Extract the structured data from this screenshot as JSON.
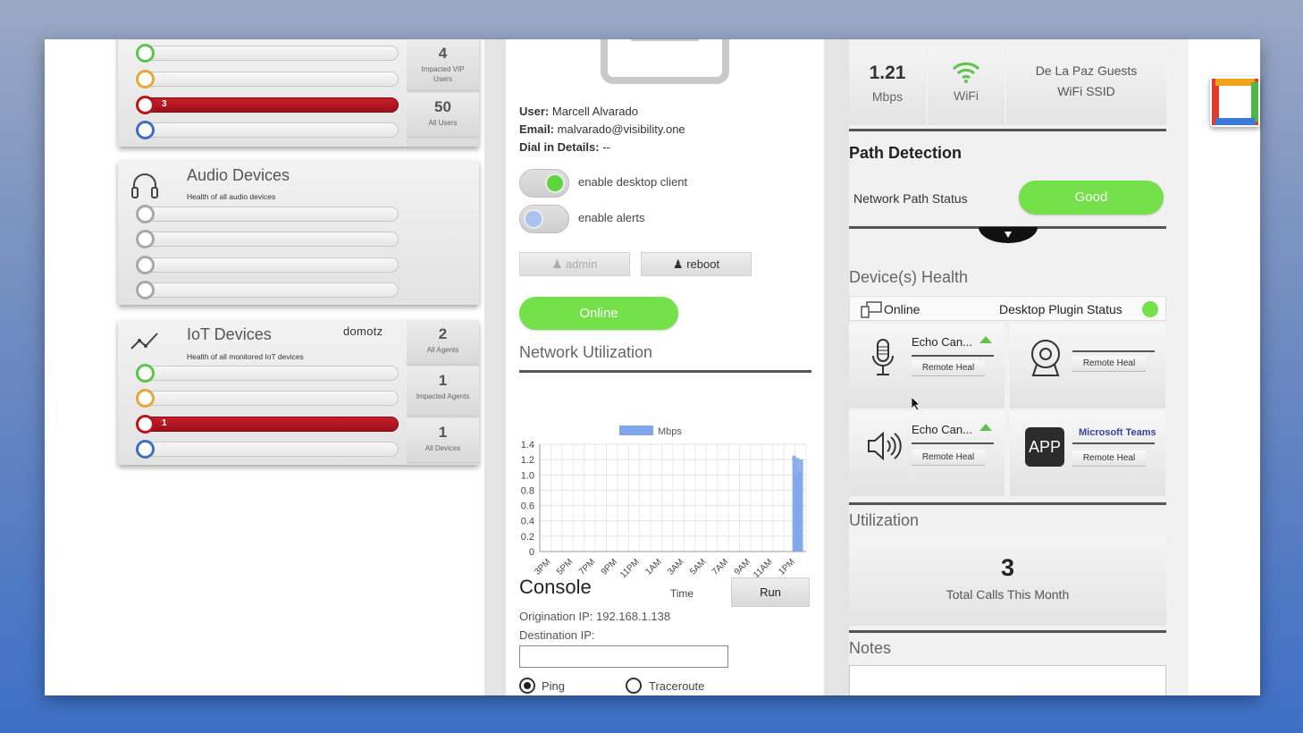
{
  "left": {
    "users_card": {
      "bars": [
        {
          "value": "0",
          "color": "green"
        },
        {
          "value": "0",
          "color": "orange"
        },
        {
          "value": "3",
          "color": "red"
        },
        {
          "value": "0",
          "color": "blue"
        }
      ],
      "stats": [
        {
          "num": "4",
          "label": "Impacted VIP Users"
        },
        {
          "num": "50",
          "label": "All Users"
        }
      ]
    },
    "audio_card": {
      "title": "Audio Devices",
      "subtitle": "Health of all audio devices"
    },
    "iot_card": {
      "title": "IoT Devices",
      "subtitle": "Health of all monitored IoT devices",
      "brand": "domotz",
      "bars": [
        {
          "value": "0",
          "color": "green"
        },
        {
          "value": "0",
          "color": "orange"
        },
        {
          "value": "1",
          "color": "red"
        },
        {
          "value": "0",
          "color": "blue"
        }
      ],
      "stats": [
        {
          "num": "2",
          "label": "All Agents"
        },
        {
          "num": "1",
          "label": "Impacted Agents"
        },
        {
          "num": "1",
          "label": "All Devices"
        }
      ]
    }
  },
  "user": {
    "user_label": "User:",
    "user_value": "Marcell Alvarado",
    "email_label": "Email:",
    "email_value": "malvarado@visibility.one",
    "dial_label": "Dial in Details:",
    "dial_value": "--",
    "toggle_desktop": "enable desktop client",
    "toggle_alerts": "enable alerts",
    "admin_btn": "admin",
    "reboot_btn": "reboot",
    "status_btn": "Online"
  },
  "network": {
    "title": "Network Utilization"
  },
  "chart_data": {
    "type": "bar",
    "legend": [
      "Mbps"
    ],
    "xlabel": "Time",
    "ylabel": "",
    "ylim": [
      0,
      1.4
    ],
    "yticks": [
      "0",
      "0.2",
      "0.4",
      "0.6",
      "0.8",
      "1.0",
      "1.2",
      "1.4"
    ],
    "categories": [
      "3PM",
      "5PM",
      "7PM",
      "9PM",
      "11PM",
      "1AM",
      "3AM",
      "5AM",
      "7AM",
      "9AM",
      "11AM",
      "1PM"
    ],
    "series": [
      {
        "name": "Mbps",
        "x_fraction": [
          0.955,
          0.962,
          0.968,
          0.975,
          0.982
        ],
        "values": [
          1.25,
          1.0,
          1.22,
          1.05,
          1.2
        ]
      }
    ],
    "colors": {
      "bar": "#7fa6e8"
    }
  },
  "console": {
    "title": "Console",
    "run_btn": "Run",
    "origination": "Origination IP: 192.168.1.138",
    "destination_label": "Destination IP:",
    "destination_value": "",
    "radio_ping": "Ping",
    "radio_traceroute": "Traceroute"
  },
  "right": {
    "speed_value": "1.21",
    "speed_unit": "Mbps",
    "conn_type": "WiFi",
    "ssid": "De La Paz Guests WiFi SSID",
    "path_title": "Path Detection",
    "path_status_label": "Network Path Status",
    "path_status_value": "Good",
    "health_title": "Device(s) Health",
    "health_online": "Online",
    "plugin_status": "Desktop Plugin Status",
    "tiles": [
      {
        "title": "Echo Can...",
        "heal": "Remote Heal",
        "icon": "microphone-icon"
      },
      {
        "title": "",
        "heal": "Remote Heal",
        "icon": "webcam-icon"
      },
      {
        "title": "Echo Can...",
        "heal": "Remote Heal",
        "icon": "speaker-icon"
      },
      {
        "title": "Microsoft Teams",
        "heal": "Remote Heal",
        "icon": "app-icon",
        "badge": "APP"
      }
    ],
    "util_title": "Utilization",
    "calls_num": "3",
    "calls_label": "Total Calls This Month",
    "notes_title": "Notes"
  },
  "colors": {
    "green": "#74e04a",
    "red": "#b8141e",
    "blue": "#3f6ec0",
    "orange": "#e6a834",
    "teams": "#3b3f9e"
  }
}
